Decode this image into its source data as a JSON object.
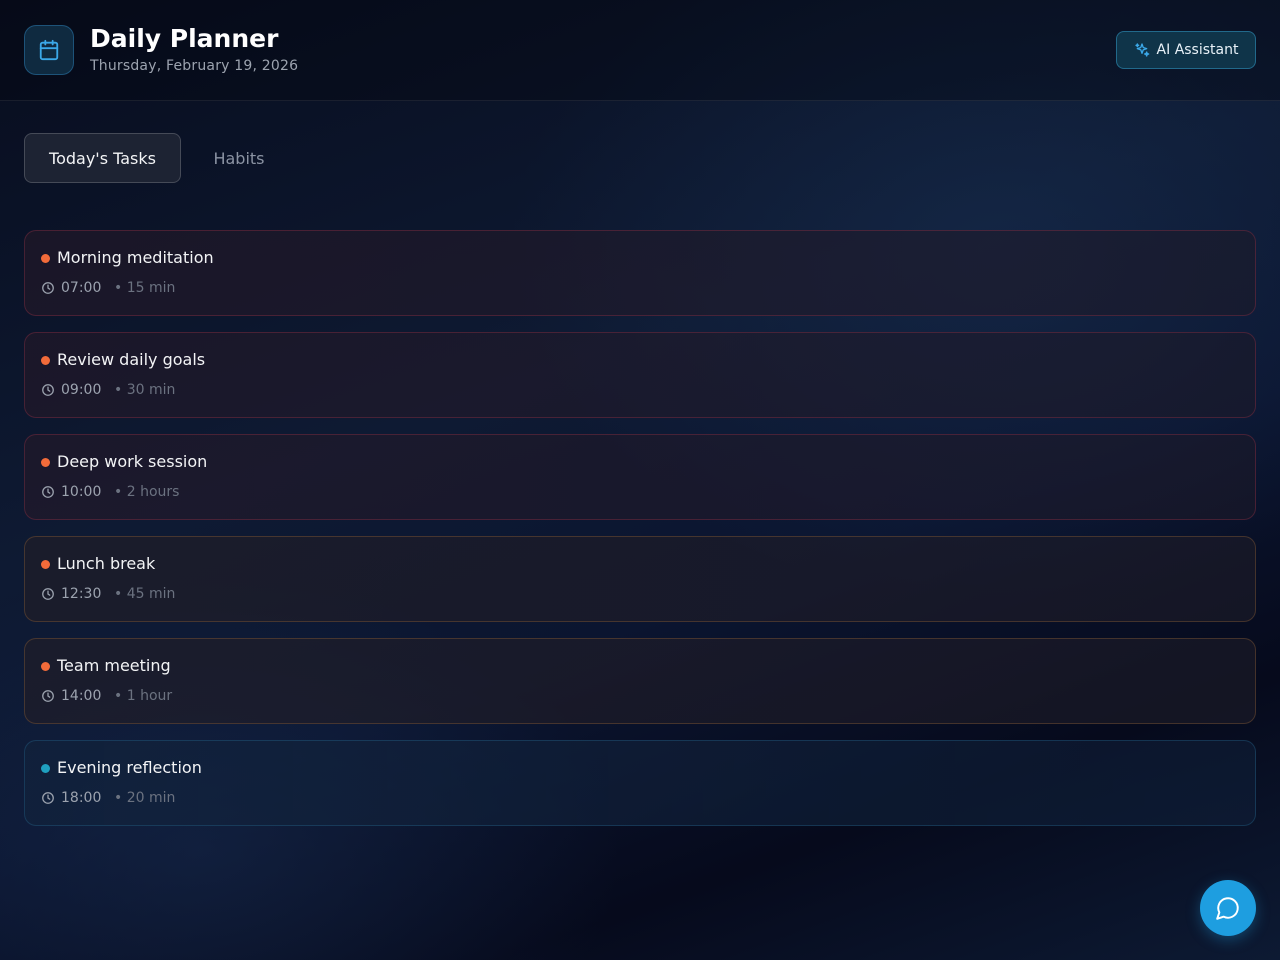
{
  "header": {
    "title": "Daily Planner",
    "date": "Thursday, February 19, 2026",
    "logo_icon": "calendar-icon",
    "ai_button_label": "AI Assistant",
    "ai_button_icon": "sparkles-icon"
  },
  "tabs": [
    {
      "label": "Today's Tasks",
      "active": true
    },
    {
      "label": "Habits",
      "active": false
    }
  ],
  "tasks": [
    {
      "title": "Morning meditation",
      "time": "07:00",
      "duration": "• 15 min"
    },
    {
      "title": "Review daily goals",
      "time": "09:00",
      "duration": "• 30 min"
    },
    {
      "title": "Deep work session",
      "time": "10:00",
      "duration": "• 2 hours"
    },
    {
      "title": "Lunch break",
      "time": "12:30",
      "duration": "• 45 min"
    },
    {
      "title": "Team meeting",
      "time": "14:00",
      "duration": "• 1 hour"
    },
    {
      "title": "Evening reflection",
      "time": "18:00",
      "duration": "• 20 min"
    }
  ],
  "colors": {
    "accent": "#1e9ee0",
    "task_dot": "#f26b3a",
    "task_dot_alt": "#1fa0c0"
  },
  "chat_button_icon": "chat-bubble-icon"
}
